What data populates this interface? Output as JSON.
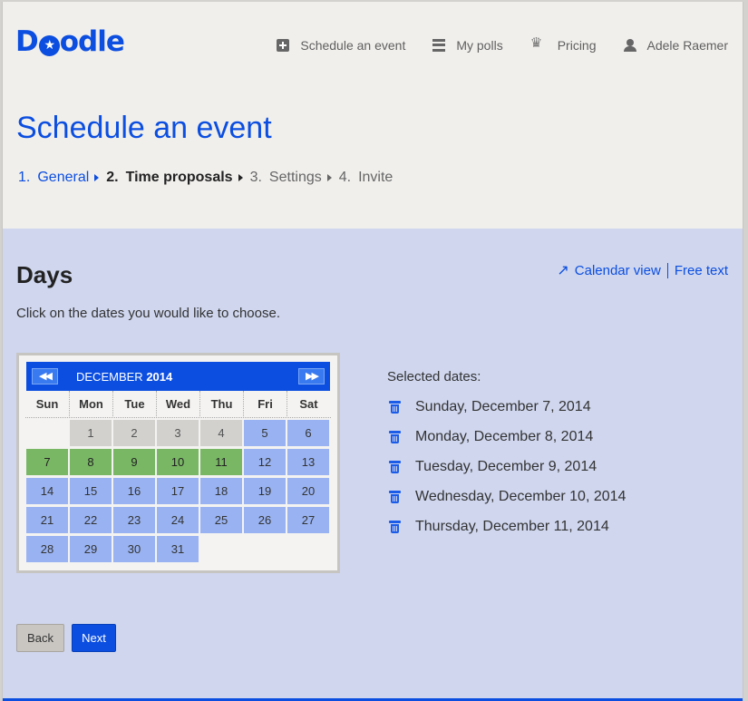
{
  "header": {
    "logo_text": "Doodle",
    "nav": [
      {
        "label": "Schedule an event",
        "icon": "plus-square-icon"
      },
      {
        "label": "My polls",
        "icon": "list-icon"
      },
      {
        "label": "Pricing",
        "icon": "crown-icon"
      },
      {
        "label": "Adele Raemer",
        "icon": "user-icon"
      }
    ],
    "title": "Schedule an event",
    "steps": [
      {
        "num": "1.",
        "label": "General",
        "state": "done"
      },
      {
        "num": "2.",
        "label": "Time proposals",
        "state": "active"
      },
      {
        "num": "3.",
        "label": "Settings",
        "state": "todo"
      },
      {
        "num": "4.",
        "label": "Invite",
        "state": "todo"
      }
    ]
  },
  "main": {
    "section_title": "Days",
    "instruction": "Click on the dates you would like to choose.",
    "calendar_view_label": "Calendar view",
    "free_text_label": "Free text",
    "calendar": {
      "month": "DECEMBER",
      "year": "2014",
      "prev_label": "◀◀",
      "next_label": "▶▶",
      "weekdays": [
        "Sun",
        "Mon",
        "Tue",
        "Wed",
        "Thu",
        "Fri",
        "Sat"
      ],
      "days": [
        {
          "d": "",
          "s": "blank"
        },
        {
          "d": "1",
          "s": "past"
        },
        {
          "d": "2",
          "s": "past"
        },
        {
          "d": "3",
          "s": "past"
        },
        {
          "d": "4",
          "s": "past"
        },
        {
          "d": "5",
          "s": "avail"
        },
        {
          "d": "6",
          "s": "avail"
        },
        {
          "d": "7",
          "s": "sel"
        },
        {
          "d": "8",
          "s": "sel"
        },
        {
          "d": "9",
          "s": "sel"
        },
        {
          "d": "10",
          "s": "sel"
        },
        {
          "d": "11",
          "s": "sel"
        },
        {
          "d": "12",
          "s": "avail"
        },
        {
          "d": "13",
          "s": "avail"
        },
        {
          "d": "14",
          "s": "avail"
        },
        {
          "d": "15",
          "s": "avail"
        },
        {
          "d": "16",
          "s": "avail"
        },
        {
          "d": "17",
          "s": "avail"
        },
        {
          "d": "18",
          "s": "avail"
        },
        {
          "d": "19",
          "s": "avail"
        },
        {
          "d": "20",
          "s": "avail"
        },
        {
          "d": "21",
          "s": "avail"
        },
        {
          "d": "22",
          "s": "avail"
        },
        {
          "d": "23",
          "s": "avail"
        },
        {
          "d": "24",
          "s": "avail"
        },
        {
          "d": "25",
          "s": "avail"
        },
        {
          "d": "26",
          "s": "avail"
        },
        {
          "d": "27",
          "s": "avail"
        },
        {
          "d": "28",
          "s": "avail"
        },
        {
          "d": "29",
          "s": "avail"
        },
        {
          "d": "30",
          "s": "avail"
        },
        {
          "d": "31",
          "s": "avail"
        }
      ]
    },
    "selected_label": "Selected dates:",
    "selected_dates": [
      "Sunday, December 7, 2014",
      "Monday, December 8, 2014",
      "Tuesday, December 9, 2014",
      "Wednesday, December 10, 2014",
      "Thursday, December 11, 2014"
    ],
    "back_label": "Back",
    "next_label": "Next"
  },
  "colors": {
    "brand": "#0b4ee0",
    "content_bg": "#cfd6ee",
    "header_bg": "#f1efec",
    "selected_day": "#79b765",
    "available_day": "#99b3f2",
    "past_day": "#d2d1ce"
  }
}
